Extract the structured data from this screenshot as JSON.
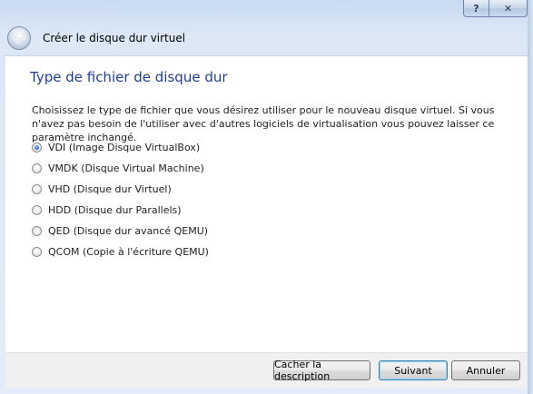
{
  "window": {
    "help_label": "?",
    "close_label": "✕"
  },
  "header": {
    "title": "Créer le disque dur virtuel",
    "back_icon": "back-arrow-icon"
  },
  "main": {
    "title": "Type de fichier de disque dur",
    "description": "Choisissez le type de fichier que vous désirez utiliser pour le nouveau disque virtuel. Si vous n'avez pas besoin de l'utiliser avec d'autres logiciels de virtualisation vous pouvez laisser ce paramètre inchangé.",
    "options": [
      {
        "label": "VDI (Image Disque VirtualBox)",
        "checked": true
      },
      {
        "label": "VMDK (Disque Virtual Machine)",
        "checked": false
      },
      {
        "label": "VHD (Disque dur Virtuel)",
        "checked": false
      },
      {
        "label": "HDD (Disque dur Parallels)",
        "checked": false
      },
      {
        "label": "QED (Disque dur avancé QEMU)",
        "checked": false
      },
      {
        "label": "QCOM (Copie à l'écriture QEMU)",
        "checked": false
      }
    ]
  },
  "footer": {
    "describe_label": "Cacher la description",
    "next_label": "Suivant",
    "cancel_label": "Annuler"
  },
  "colors": {
    "title_blue": "#1f3f8f",
    "radio_checked": "#2f6fc0"
  }
}
